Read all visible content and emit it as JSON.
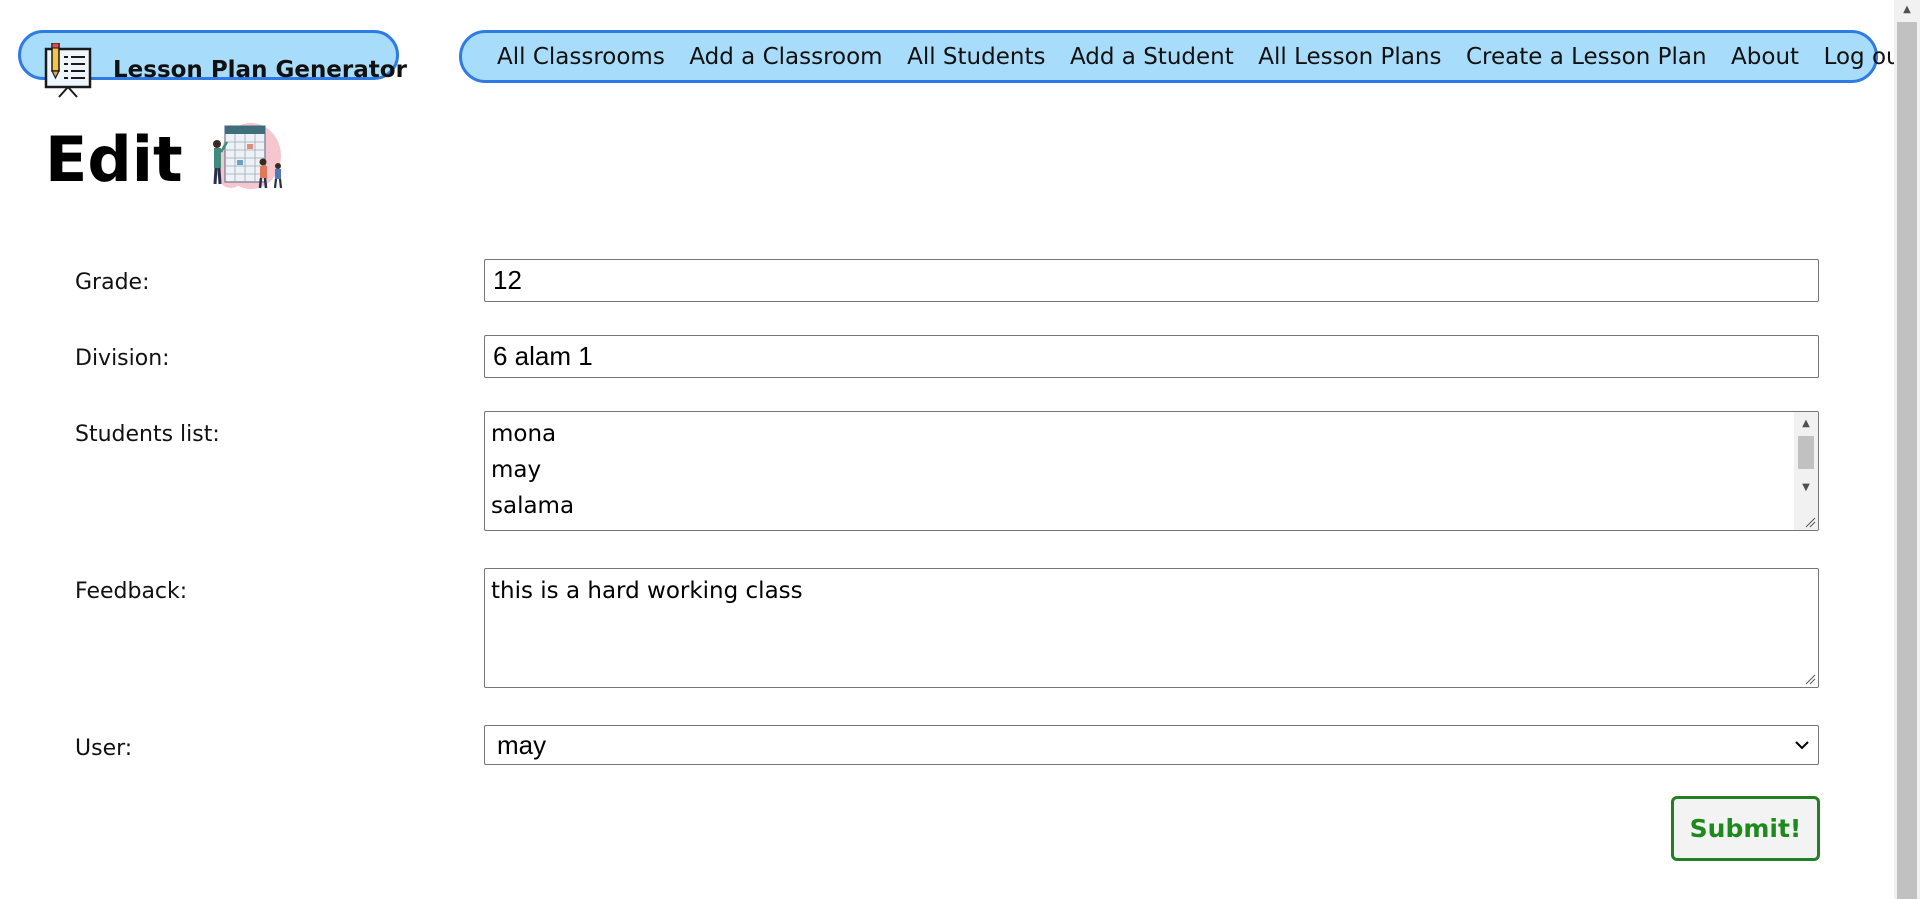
{
  "brand": {
    "title": "Lesson Plan Generator",
    "icon": "classroom-board-icon"
  },
  "nav": {
    "items": [
      {
        "label": "All Classrooms"
      },
      {
        "label": "Add a Classroom"
      },
      {
        "label": "All Students"
      },
      {
        "label": "Add a Student"
      },
      {
        "label": "All Lesson Plans"
      },
      {
        "label": "Create a Lesson Plan"
      },
      {
        "label": "About"
      },
      {
        "label": "Log out"
      }
    ]
  },
  "page": {
    "heading": "Edit",
    "heading_image": "planning-illustration"
  },
  "form": {
    "grade": {
      "label": "Grade:",
      "value": "12"
    },
    "division": {
      "label": "Division:",
      "value": "6 alam 1"
    },
    "students": {
      "label": "Students list:",
      "lines": [
        "mona",
        "may",
        "salama"
      ]
    },
    "feedback": {
      "label": "Feedback:",
      "value": "this is a hard working class"
    },
    "user": {
      "label": "User:",
      "selected": "may"
    },
    "submit_label": "Submit!"
  },
  "colors": {
    "nav_bg": "#a8dcfb",
    "nav_border": "#2e7be6",
    "submit_text": "#1d8a1d",
    "submit_border": "#218021"
  }
}
